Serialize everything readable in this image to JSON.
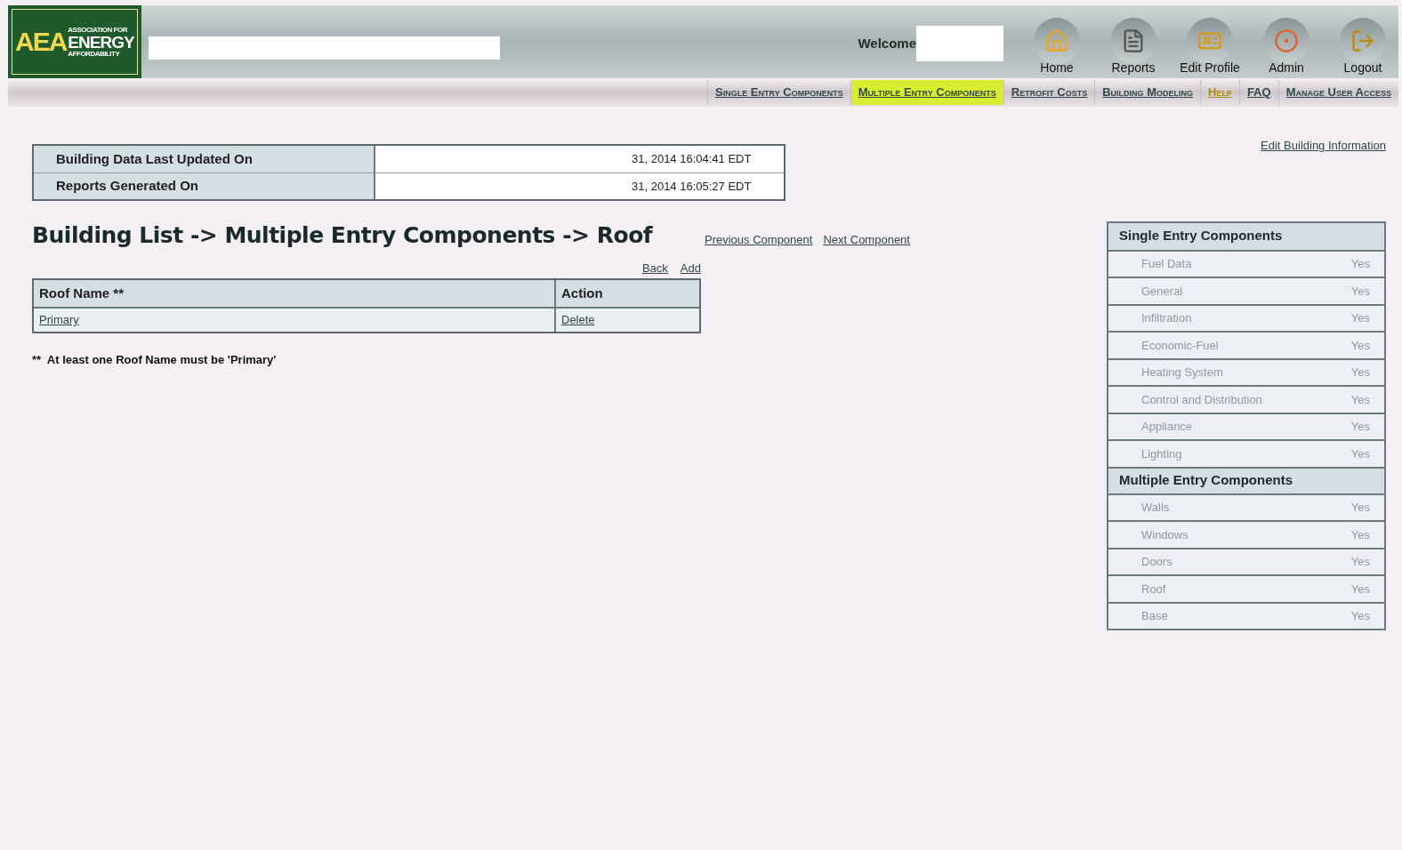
{
  "logo": {
    "mark": "AEA",
    "lines": [
      "ASSOCIATION FOR",
      "ENERGY",
      "AFFORDABILITY"
    ]
  },
  "header": {
    "welcome": "Welcome",
    "buttons": [
      {
        "kind": "home",
        "label": "Home"
      },
      {
        "kind": "reports",
        "label": "Reports"
      },
      {
        "kind": "profile",
        "label": "Edit Profile"
      },
      {
        "kind": "admin",
        "label": "Admin"
      },
      {
        "kind": "logout",
        "label": "Logout"
      }
    ]
  },
  "nav": [
    {
      "label": "Single Entry Components",
      "selected": false
    },
    {
      "label": "Multiple Entry Components",
      "selected": true
    },
    {
      "label": "Retrofit Costs",
      "selected": false
    },
    {
      "label": "Building Modeling",
      "selected": false
    },
    {
      "label": "Help",
      "selected": false,
      "highlight": true
    },
    {
      "label": "FAQ",
      "selected": false
    },
    {
      "label": "Manage User Access",
      "selected": false
    }
  ],
  "info_table": [
    {
      "label": "Building Data Last Updated On",
      "value": "31, 2014 16:04:41 EDT"
    },
    {
      "label": "Reports Generated On",
      "value": "31, 2014 16:05:27 EDT"
    }
  ],
  "edit_link": "Edit Building Information",
  "title": "Building List -> Multiple Entry Components -> Roof",
  "component_links": [
    "Previous Component",
    "Next Component"
  ],
  "table_links": [
    "Back",
    "Add"
  ],
  "table": {
    "columns": [
      "Roof Name **",
      "Action"
    ],
    "rows": [
      [
        "Primary",
        "Delete"
      ]
    ]
  },
  "footnote": "**  At least one Roof Name must be 'Primary'",
  "sidebar": [
    {
      "title": "Single Entry Components",
      "items": [
        {
          "label": "Fuel Data",
          "status": "Yes",
          "disabled": true
        },
        {
          "label": "General",
          "status": "Yes",
          "disabled": true
        },
        {
          "label": "Infiltration",
          "status": "Yes",
          "disabled": true
        },
        {
          "label": "Economic-Fuel",
          "status": "Yes",
          "disabled": true
        },
        {
          "label": "Heating System",
          "status": "Yes",
          "disabled": true
        },
        {
          "label": "Control and Distribution",
          "status": "Yes",
          "disabled": true
        },
        {
          "label": "Appliance",
          "status": "Yes",
          "disabled": true
        },
        {
          "label": "Lighting",
          "status": "Yes",
          "disabled": true
        }
      ]
    },
    {
      "title": "Multiple Entry Components",
      "items": [
        {
          "label": "Walls",
          "status": "Yes",
          "disabled": true
        },
        {
          "label": "Windows",
          "status": "Yes",
          "disabled": true
        },
        {
          "label": "Doors",
          "status": "Yes",
          "disabled": true
        },
        {
          "label": "Roof",
          "status": "Yes",
          "disabled": true
        },
        {
          "label": "Base",
          "status": "Yes",
          "disabled": true
        }
      ]
    }
  ]
}
